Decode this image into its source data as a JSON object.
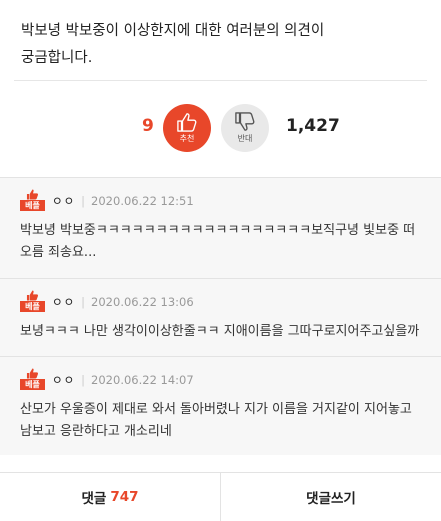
{
  "question": {
    "line1": "박보녕 박보중이 이상한지에 대한 여러분의 의견이",
    "line2": "궁금합니다."
  },
  "vote": {
    "up_count": "9",
    "up_label": "추천",
    "down_label": "반대",
    "down_count": "1,427"
  },
  "comments": [
    {
      "badge": "베플",
      "author": "ㅇㅇ",
      "date": "2020.06.22 12:51",
      "text": "박보녕 박보중ㅋㅋㅋㅋㅋㅋㅋㅋㅋㅋㅋㅋㅋㅋㅋㅋㅋㅋ보직구녕 빛보중 떠오름 죄송요..."
    },
    {
      "badge": "베플",
      "author": "ㅇㅇ",
      "date": "2020.06.22 13:06",
      "text": "보녕ㅋㅋㅋ 나만 생각이이상한줄ㅋㅋ 지애이름을 그따구로지어주고싶을까"
    },
    {
      "badge": "베플",
      "author": "ㅇㅇ",
      "date": "2020.06.22 14:07",
      "text": "산모가 우울증이 제대로 와서 돌아버렸나 지가 이름을 거지같이 지어놓고 남보고 응란하다고 개소리네"
    }
  ],
  "bottom": {
    "comments_label": "댓글",
    "comments_count": "747",
    "write_label": "댓글쓰기"
  },
  "colors": {
    "accent": "#e8472a",
    "down_bg": "#e9e9e9"
  }
}
